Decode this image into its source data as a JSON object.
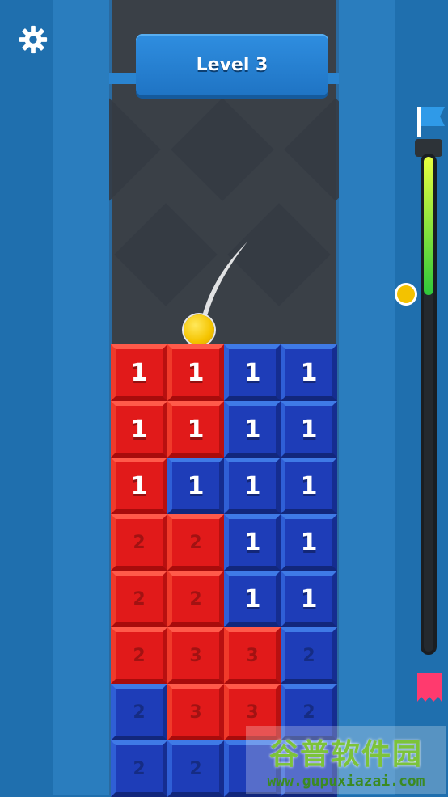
{
  "hud": {
    "level_label": "Level 3",
    "settings_icon": "gear-icon"
  },
  "progress": {
    "fraction": 0.28,
    "top_icon": "blue-flag-icon",
    "bottom_icon": "red-flag-icon",
    "colors": {
      "fill_top": "#e8ff40",
      "fill_bottom": "#2ec83a",
      "marker": "#f3c200"
    }
  },
  "board": {
    "columns": 4,
    "rows": [
      [
        {
          "c": "red",
          "n": "1"
        },
        {
          "c": "red",
          "n": "1"
        },
        {
          "c": "blue",
          "n": "1"
        },
        {
          "c": "blue",
          "n": "1"
        }
      ],
      [
        {
          "c": "red",
          "n": "1"
        },
        {
          "c": "red",
          "n": "1"
        },
        {
          "c": "blue",
          "n": "1"
        },
        {
          "c": "blue",
          "n": "1"
        }
      ],
      [
        {
          "c": "red",
          "n": "1"
        },
        {
          "c": "blue",
          "n": "1"
        },
        {
          "c": "blue",
          "n": "1"
        },
        {
          "c": "blue",
          "n": "1"
        }
      ],
      [
        {
          "c": "red",
          "n": "2"
        },
        {
          "c": "red",
          "n": "2"
        },
        {
          "c": "blue",
          "n": "1"
        },
        {
          "c": "blue",
          "n": "1"
        }
      ],
      [
        {
          "c": "red",
          "n": "2"
        },
        {
          "c": "red",
          "n": "2"
        },
        {
          "c": "blue",
          "n": "1"
        },
        {
          "c": "blue",
          "n": "1"
        }
      ],
      [
        {
          "c": "red",
          "n": "2"
        },
        {
          "c": "red",
          "n": "3"
        },
        {
          "c": "red",
          "n": "3"
        },
        {
          "c": "blue",
          "n": "2"
        }
      ],
      [
        {
          "c": "blue",
          "n": "2"
        },
        {
          "c": "red",
          "n": "3"
        },
        {
          "c": "red",
          "n": "3"
        },
        {
          "c": "blue",
          "n": "2"
        }
      ],
      [
        {
          "c": "blue",
          "n": "2"
        },
        {
          "c": "blue",
          "n": "2"
        },
        {
          "c": "blue",
          "n": ""
        },
        {
          "c": "blue",
          "n": ""
        }
      ]
    ],
    "colors": {
      "red": "#e11a1a",
      "blue": "#1e3db8"
    }
  },
  "watermark": {
    "title": "谷普软件园",
    "url": "www.gupuxiazai.com"
  }
}
